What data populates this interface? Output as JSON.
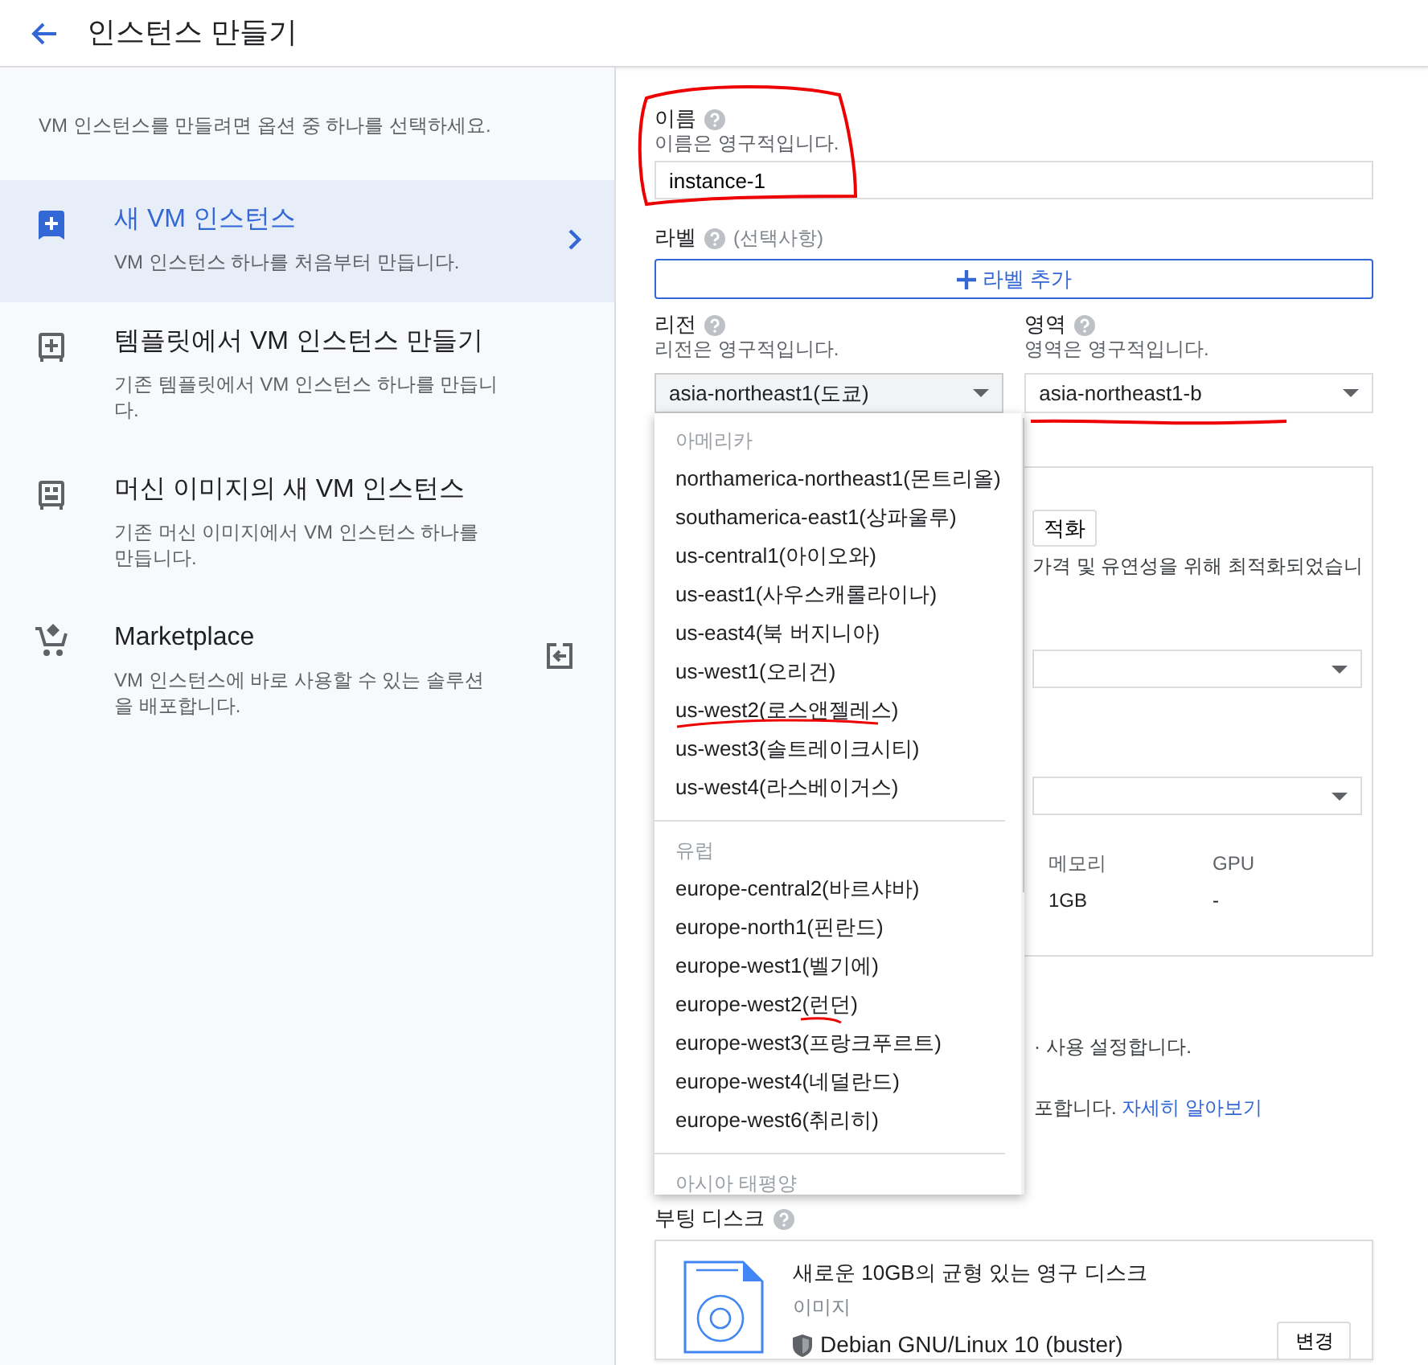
{
  "header": {
    "title": "인스턴스 만들기"
  },
  "sidebar": {
    "intro": "VM 인스턴스를 만들려면 옵션 중 하나를 선택하세요.",
    "options": [
      {
        "kind": "new",
        "title": "새 VM 인스턴스",
        "description": "VM 인스턴스 하나를 처음부터 만듭니다.",
        "selected": true
      },
      {
        "kind": "template",
        "title": "템플릿에서 VM 인스턴스 만들기",
        "description": "기존 템플릿에서 VM 인스턴스 하나를 만듭니다.",
        "selected": false
      },
      {
        "kind": "image",
        "title": "머신 이미지의 새 VM 인스턴스",
        "description": "기존 머신 이미지에서 VM 인스턴스 하나를 만듭니다.",
        "selected": false
      },
      {
        "kind": "marketplace",
        "title": "Marketplace",
        "description": "VM 인스턴스에 바로 사용할 수 있는 솔루션을 배포합니다.",
        "selected": false
      }
    ]
  },
  "form": {
    "name": {
      "label": "이름",
      "hint": "이름은 영구적입니다.",
      "value": "instance-1"
    },
    "labels": {
      "label": "라벨",
      "optional": "(선택사항)",
      "button": "라벨 추가"
    },
    "region": {
      "label": "리전",
      "hint": "리전은 영구적입니다.",
      "value": "asia-northeast1(도쿄)"
    },
    "zone": {
      "label": "영역",
      "hint": "영역은 영구적입니다.",
      "value": "asia-northeast1-b"
    }
  },
  "region_menu": {
    "groups": [
      {
        "heading": "아메리카",
        "items": [
          "northamerica-northeast1(몬트리올)",
          "southamerica-east1(상파울루)",
          "us-central1(아이오와)",
          "us-east1(사우스캐롤라이나)",
          "us-east4(북 버지니아)",
          "us-west1(오리건)",
          "us-west2(로스앤젤레스)",
          "us-west3(솔트레이크시티)",
          "us-west4(라스베이거스)"
        ]
      },
      {
        "heading": "유럽",
        "items": [
          "europe-central2(바르샤바)",
          "europe-north1(핀란드)",
          "europe-west1(벨기에)",
          "europe-west2(런던)",
          "europe-west3(프랑크푸르트)",
          "europe-west4(네덜란드)",
          "europe-west6(취리히)"
        ]
      },
      {
        "heading": "아시아 태평양"
      }
    ]
  },
  "machine_card": {
    "button": "적화",
    "note": "가격 및 유연성을 위해 최적화되었습니",
    "specs": [
      {
        "heading": "메모리",
        "value": "1GB"
      },
      {
        "heading": "GPU",
        "value": "-"
      }
    ]
  },
  "notes": [
    {
      "text": "· 사용 설정합니다."
    },
    {
      "text": "포합니다.",
      "link": "자세히 알아보기"
    }
  ],
  "boot_disk": {
    "label": "부팅 디스크",
    "title": "새로운 10GB의 균형 있는 영구 디스크",
    "image_label": "이미지",
    "image": "Debian GNU/Linux 10 (buster)",
    "button": "변경"
  }
}
